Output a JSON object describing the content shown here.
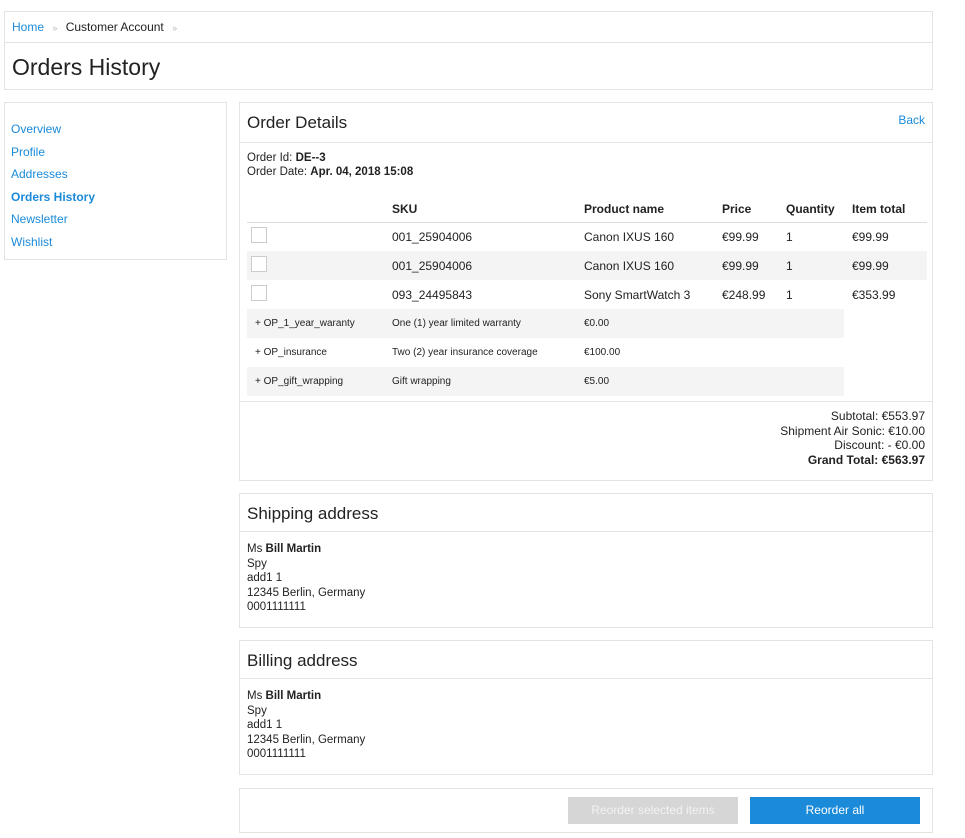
{
  "breadcrumb": {
    "home": "Home",
    "account": "Customer Account",
    "sep": "»"
  },
  "page_title": "Orders History",
  "sidebar": {
    "items": [
      {
        "label": "Overview"
      },
      {
        "label": "Profile"
      },
      {
        "label": "Addresses"
      },
      {
        "label": "Orders History",
        "active": true
      },
      {
        "label": "Newsletter"
      },
      {
        "label": "Wishlist"
      }
    ]
  },
  "order": {
    "title": "Order Details",
    "back": "Back",
    "id_label": "Order Id:",
    "id_value": "DE--3",
    "date_label": "Order Date:",
    "date_value": "Apr. 04, 2018 15:08",
    "columns": [
      "SKU",
      "Product name",
      "Price",
      "Quantity",
      "Item total"
    ],
    "items": [
      {
        "sku": "001_25904006",
        "name": "Canon IXUS 160",
        "price": "€99.99",
        "qty": "1",
        "total": "€99.99"
      },
      {
        "sku": "001_25904006",
        "name": "Canon IXUS 160",
        "price": "€99.99",
        "qty": "1",
        "total": "€99.99"
      },
      {
        "sku": "093_24495843",
        "name": "Sony SmartWatch 3",
        "price": "€248.99",
        "qty": "1",
        "total": "€353.99"
      }
    ],
    "options": [
      {
        "key": "+ OP_1_year_waranty",
        "desc": "One (1) year limited warranty",
        "price": "€0.00"
      },
      {
        "key": "+ OP_insurance",
        "desc": "Two (2) year insurance coverage",
        "price": "€100.00"
      },
      {
        "key": "+ OP_gift_wrapping",
        "desc": "Gift wrapping",
        "price": "€5.00"
      }
    ],
    "totals": {
      "subtotal": "Subtotal: €553.97",
      "shipment": "Shipment Air Sonic: €10.00",
      "discount": "Discount: - €0.00",
      "grand": "Grand Total: €563.97"
    }
  },
  "shipping": {
    "title": "Shipping address",
    "salutation": "Ms",
    "name": "Bill Martin",
    "company": "Spy",
    "street": "add1 1",
    "city": "12345 Berlin, Germany",
    "phone": "0001111111"
  },
  "billing": {
    "title": "Billing address",
    "salutation": "Ms",
    "name": "Bill Martin",
    "company": "Spy",
    "street": "add1 1",
    "city": "12345 Berlin, Germany",
    "phone": "0001111111"
  },
  "actions": {
    "reorder_selected": "Reorder selected items",
    "reorder_all": "Reorder all"
  }
}
